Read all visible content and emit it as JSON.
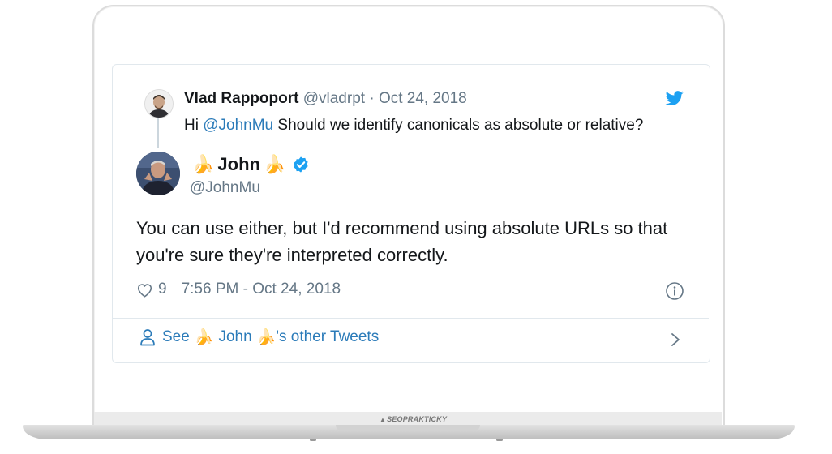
{
  "tweet": {
    "reply": {
      "name": "Vlad Rappoport",
      "handle": "@vladrpt",
      "separator": " · ",
      "date": "Oct 24, 2018",
      "text_prefix": "Hi ",
      "mention": "@JohnMu",
      "text_rest": " Should we identify canonicals as absolute or relative?"
    },
    "author": {
      "emoji_left": "🍌",
      "name": "John",
      "emoji_right": "🍌",
      "handle": "@JohnMu"
    },
    "body": "You can use either, but I'd recommend using absolute URLs so that you're sure they're interpreted correctly.",
    "likes": "9",
    "timestamp": "7:56 PM - Oct 24, 2018",
    "other_tweets": {
      "prefix": "See",
      "emoji_left": "🍌",
      "name": "John",
      "emoji_right": "🍌",
      "suffix": "'s other Tweets"
    }
  },
  "laptop": {
    "brand": "SEOPRAKTICKY"
  },
  "colors": {
    "twitter_blue": "#1da1f2",
    "link": "#2b7bb9",
    "muted": "#657786"
  }
}
